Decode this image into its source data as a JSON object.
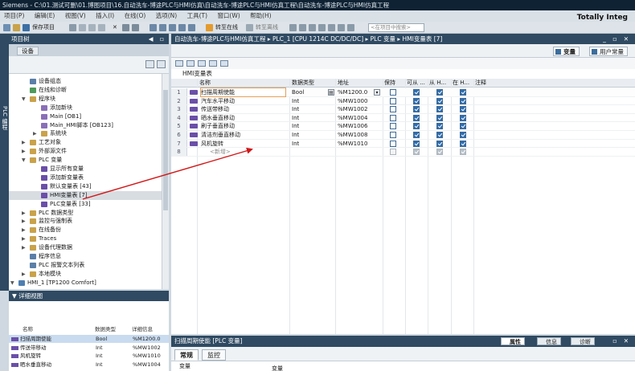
{
  "window": {
    "title": "Siemens  -  C:\\01.测试可删\\01.博图项目\\16.自动洗车-博途PLC与HMI仿真\\自动洗车-博途PLC与HMI仿真工程\\自动洗车-博途PLC与HMI仿真工程"
  },
  "menu": {
    "items": [
      "项目(P)",
      "编辑(E)",
      "视图(V)",
      "插入(I)",
      "在线(O)",
      "选项(N)",
      "工具(T)",
      "窗口(W)",
      "帮助(H)"
    ],
    "brand": "Totally Integ"
  },
  "toolbar": {
    "save_project": "保存项目",
    "go_online": "转至在线",
    "go_offline": "转至离线",
    "search_placeholder": "<在项目中搜索>"
  },
  "side_tab": {
    "label": "PLC 编程"
  },
  "project_tree": {
    "title": "项目树",
    "devices_tab": "设备",
    "items": [
      {
        "label": "设备组态",
        "indent": 0,
        "twisty": "",
        "icon_color": "#5b7fa8"
      },
      {
        "label": "在线和诊断",
        "indent": 0,
        "twisty": "",
        "icon_color": "#4d9a5a"
      },
      {
        "label": "程序块",
        "indent": 0,
        "twisty": "▼",
        "icon_color": "#c9a24a"
      },
      {
        "label": "添加新块",
        "indent": 1,
        "twisty": "",
        "icon_color": "#8a6fb8"
      },
      {
        "label": "Main [OB1]",
        "indent": 1,
        "twisty": "",
        "icon_color": "#8a6fb8"
      },
      {
        "label": "Main_HMI脚本 [OB123]",
        "indent": 1,
        "twisty": "",
        "icon_color": "#8a6fb8"
      },
      {
        "label": "系统块",
        "indent": 1,
        "twisty": "▶",
        "icon_color": "#c9a24a"
      },
      {
        "label": "工艺对象",
        "indent": 0,
        "twisty": "▶",
        "icon_color": "#c9a24a"
      },
      {
        "label": "外部源文件",
        "indent": 0,
        "twisty": "▶",
        "icon_color": "#c9a24a"
      },
      {
        "label": "PLC 变量",
        "indent": 0,
        "twisty": "▼",
        "icon_color": "#c9a24a"
      },
      {
        "label": "显示所有变量",
        "indent": 1,
        "twisty": "",
        "icon_color": "#6b4fa8"
      },
      {
        "label": "添加新变量表",
        "indent": 1,
        "twisty": "",
        "icon_color": "#6b4fa8"
      },
      {
        "label": "默认变量表 [43]",
        "indent": 1,
        "twisty": "",
        "icon_color": "#6b4fa8"
      },
      {
        "label": "HMI变量表 [7]",
        "indent": 1,
        "twisty": "",
        "icon_color": "#6b4fa8",
        "selected": true
      },
      {
        "label": "PLC变量表 [33]",
        "indent": 1,
        "twisty": "",
        "icon_color": "#6b4fa8"
      },
      {
        "label": "PLC 数据类型",
        "indent": 0,
        "twisty": "▶",
        "icon_color": "#c9a24a"
      },
      {
        "label": "监控与强制表",
        "indent": 0,
        "twisty": "▶",
        "icon_color": "#c9a24a"
      },
      {
        "label": "在线备份",
        "indent": 0,
        "twisty": "▶",
        "icon_color": "#c9a24a"
      },
      {
        "label": "Traces",
        "indent": 0,
        "twisty": "▶",
        "icon_color": "#c9a24a"
      },
      {
        "label": "设备代理数据",
        "indent": 0,
        "twisty": "▶",
        "icon_color": "#c9a24a"
      },
      {
        "label": "程序信息",
        "indent": 0,
        "twisty": "",
        "icon_color": "#5b7fa8"
      },
      {
        "label": "PLC 报警文本列表",
        "indent": 0,
        "twisty": "",
        "icon_color": "#5b7fa8"
      },
      {
        "label": "本地模块",
        "indent": 0,
        "twisty": "▶",
        "icon_color": "#c9a24a"
      },
      {
        "label": "HMI_1 [TP1200 Comfort]",
        "indent": -1,
        "twisty": "▼",
        "icon_color": "#4e7fb0"
      }
    ]
  },
  "detail_view": {
    "title": "详细视图",
    "columns": [
      "名称",
      "数据类型",
      "详细信息"
    ],
    "rows": [
      {
        "name": "扫描周期使能",
        "type": "Bool",
        "detail": "%M1200.0",
        "selected": true
      },
      {
        "name": "传送带移动",
        "type": "Int",
        "detail": "%MW1002"
      },
      {
        "name": "风机旋转",
        "type": "Int",
        "detail": "%MW1010"
      },
      {
        "name": "晒水垂直移动",
        "type": "Int",
        "detail": "%MW1004"
      }
    ]
  },
  "editor": {
    "breadcrumb": "自动洗车-博途PLC与HMI仿真工程  ▸  PLC_1 [CPU 1214C DC/DC/DC]  ▸  PLC 变量  ▸  HMI变量表 [7]",
    "tab_tags": "变量",
    "tab_usertypes": "用户常量",
    "table_title": "HMI变量表",
    "columns": {
      "name": "名称",
      "type": "数据类型",
      "address": "地址",
      "retain": "保持",
      "access": "可从 ...",
      "write": "从 H...",
      "visible": "在 H...",
      "comment": "注释"
    },
    "rows": [
      {
        "num": "1",
        "name": "扫描周期使能",
        "type": "Bool",
        "address": "%M1200.0",
        "access": true,
        "write": true,
        "visible": true
      },
      {
        "num": "2",
        "name": "汽车水平移动",
        "type": "Int",
        "address": "%MW1000",
        "access": true,
        "write": true,
        "visible": true
      },
      {
        "num": "3",
        "name": "传送带移动",
        "type": "Int",
        "address": "%MW1002",
        "access": true,
        "write": true,
        "visible": true
      },
      {
        "num": "4",
        "name": "晒水垂直移动",
        "type": "Int",
        "address": "%MW1004",
        "access": true,
        "write": true,
        "visible": true
      },
      {
        "num": "5",
        "name": "刷子垂直移动",
        "type": "Int",
        "address": "%MW1006",
        "access": true,
        "write": true,
        "visible": true
      },
      {
        "num": "6",
        "name": "清洁剂垂直移动",
        "type": "Int",
        "address": "%MW1008",
        "access": true,
        "write": true,
        "visible": true
      },
      {
        "num": "7",
        "name": "风机旋转",
        "type": "Int",
        "address": "%MW1010",
        "access": true,
        "write": true,
        "visible": true
      }
    ],
    "new_row": {
      "num": "8",
      "name": "<新增>"
    }
  },
  "properties": {
    "title": "扫描周期使能 [PLC 变量]",
    "tab_properties": "属性",
    "tab_info": "信息",
    "tab_diagnostics": "诊断",
    "tab_general": "常规",
    "tab_monitor": "监控",
    "sub_tag": "变量",
    "sub_tag2": "变量"
  },
  "colors": {
    "panel_header": "#2f4a62",
    "tag_icon": "#6b4fa8",
    "checkbox_on": "#2e6db0",
    "arrow": "#d01818"
  }
}
